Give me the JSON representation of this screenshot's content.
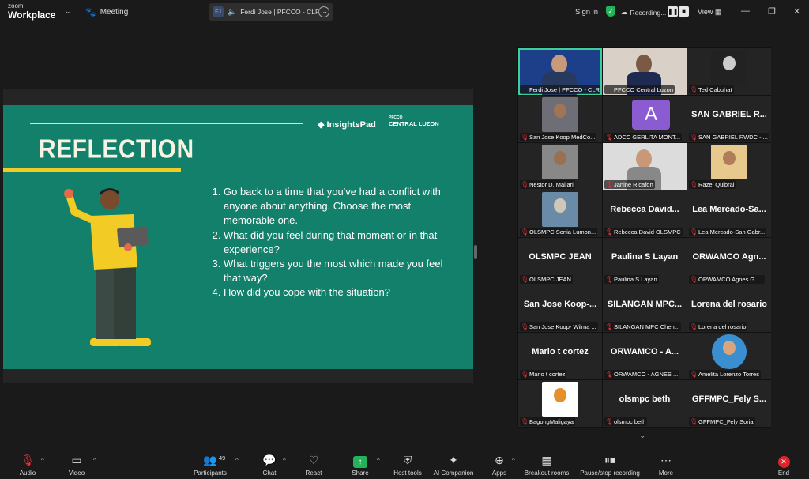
{
  "topbar": {
    "brand_small": "zoom",
    "brand_big": "Workplace",
    "meeting_label": "Meeting",
    "speaker_initials": "FJ",
    "speaker_name": "Ferdi Jose | PFCCO - CLRL's s",
    "signin": "Sign in",
    "recording": "Recording...",
    "view": "View"
  },
  "slide": {
    "logo_insights": "InsightsPad",
    "logo_pfcco_small": "PFCCO",
    "logo_central": "CENTRAL LUZON",
    "title": "REFLECTION",
    "q1": "Go back to a time that  you've had a conflict with anyone about anything. Choose the most memorable one.",
    "q2": "What did you feel during that moment or in that experience?",
    "q3": "What triggers you the most which made you feel that way?",
    "q4": "How did you cope with the situation?"
  },
  "gallery": {
    "tiles": [
      {
        "label": "Ferdi Jose | PFCCO - CLRL",
        "big": ""
      },
      {
        "label": "PFCCO Central Luzon",
        "big": ""
      },
      {
        "label": "Ted Cabuhat",
        "big": ""
      },
      {
        "label": "San Jose Koop MedCo...",
        "big": ""
      },
      {
        "label": "ADCC GERLITA MONT...",
        "big": "",
        "avatar": "A"
      },
      {
        "label": "SAN GABRIEL RWDC - ...",
        "big": "SAN GABRIEL R..."
      },
      {
        "label": "Nestor D. Mallari",
        "big": ""
      },
      {
        "label": "Janine Ricafort",
        "big": ""
      },
      {
        "label": "Razel Quibral",
        "big": ""
      },
      {
        "label": "OLSMPC Sonia Lumon...",
        "big": ""
      },
      {
        "label": "Rebecca David OLSMPC",
        "big": "Rebecca  David..."
      },
      {
        "label": "Lea Mercado-San Gabr...",
        "big": "Lea  Mercado-Sa..."
      },
      {
        "label": "OLSMPC JEAN",
        "big": "OLSMPC  JEAN"
      },
      {
        "label": "Paulina S Layan",
        "big": "Paulina S Layan"
      },
      {
        "label": "ORWAMCO Agnes G. ...",
        "big": "ORWAMCO  Agn..."
      },
      {
        "label": "San Jose Koop- Wilma ...",
        "big": "San Jose Koop-..."
      },
      {
        "label": "SILANGAN MPC Cherr...",
        "big": "SILANGAN  MPC..."
      },
      {
        "label": "Lorena del rosario",
        "big": "Lorena del rosario"
      },
      {
        "label": "Mario t cortez",
        "big": "Mario t cortez"
      },
      {
        "label": "ORWAMCO - AGNES ...",
        "big": "ORWAMCO  -  A..."
      },
      {
        "label": "Amelita Lorenzo Torres",
        "big": ""
      },
      {
        "label": "BagongMaligaya",
        "big": ""
      },
      {
        "label": "olsmpc beth",
        "big": "olsmpc beth"
      },
      {
        "label": "GFFMPC_Fely Soria",
        "big": "GFFMPC_Fely S..."
      }
    ]
  },
  "toolbar": {
    "audio": "Audio",
    "video": "Video",
    "participants": "Participants",
    "participants_count": "49",
    "chat": "Chat",
    "react": "React",
    "share": "Share",
    "host_tools": "Host tools",
    "ai_companion": "AI Companion",
    "apps": "Apps",
    "breakout": "Breakout rooms",
    "pause_rec": "Pause/stop recording",
    "more": "More",
    "end": "End"
  },
  "colors": {
    "slide_bg": "#12806a",
    "accent_yellow": "#f2cc25",
    "share_green": "#23b35a",
    "end_red": "#e0232b",
    "active_speaker": "#3ccf9a"
  }
}
